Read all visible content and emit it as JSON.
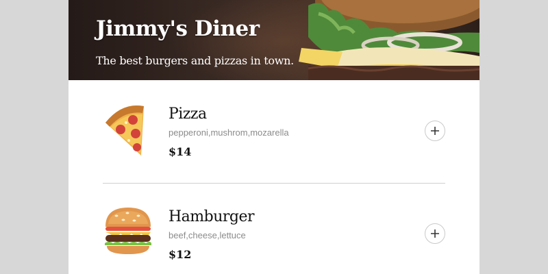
{
  "restaurant": {
    "name": "Jimmy's Diner",
    "tagline": "The best burgers and pizzas in town."
  },
  "menu": {
    "items": [
      {
        "name": "Pizza",
        "ingredients": "pepperoni,mushrom,mozarella",
        "price": "$14",
        "icon": "pizza-icon"
      },
      {
        "name": "Hamburger",
        "ingredients": "beef,cheese,lettuce",
        "price": "$12",
        "icon": "hamburger-icon"
      }
    ],
    "add_button_icon": "plus-icon"
  },
  "colors": {
    "page_background": "#d7d7d7",
    "card_background": "#ffffff",
    "hero_dark": "#241a17",
    "text_primary": "#111111",
    "text_secondary": "#8b8b8b",
    "divider": "#cfcfcf"
  }
}
